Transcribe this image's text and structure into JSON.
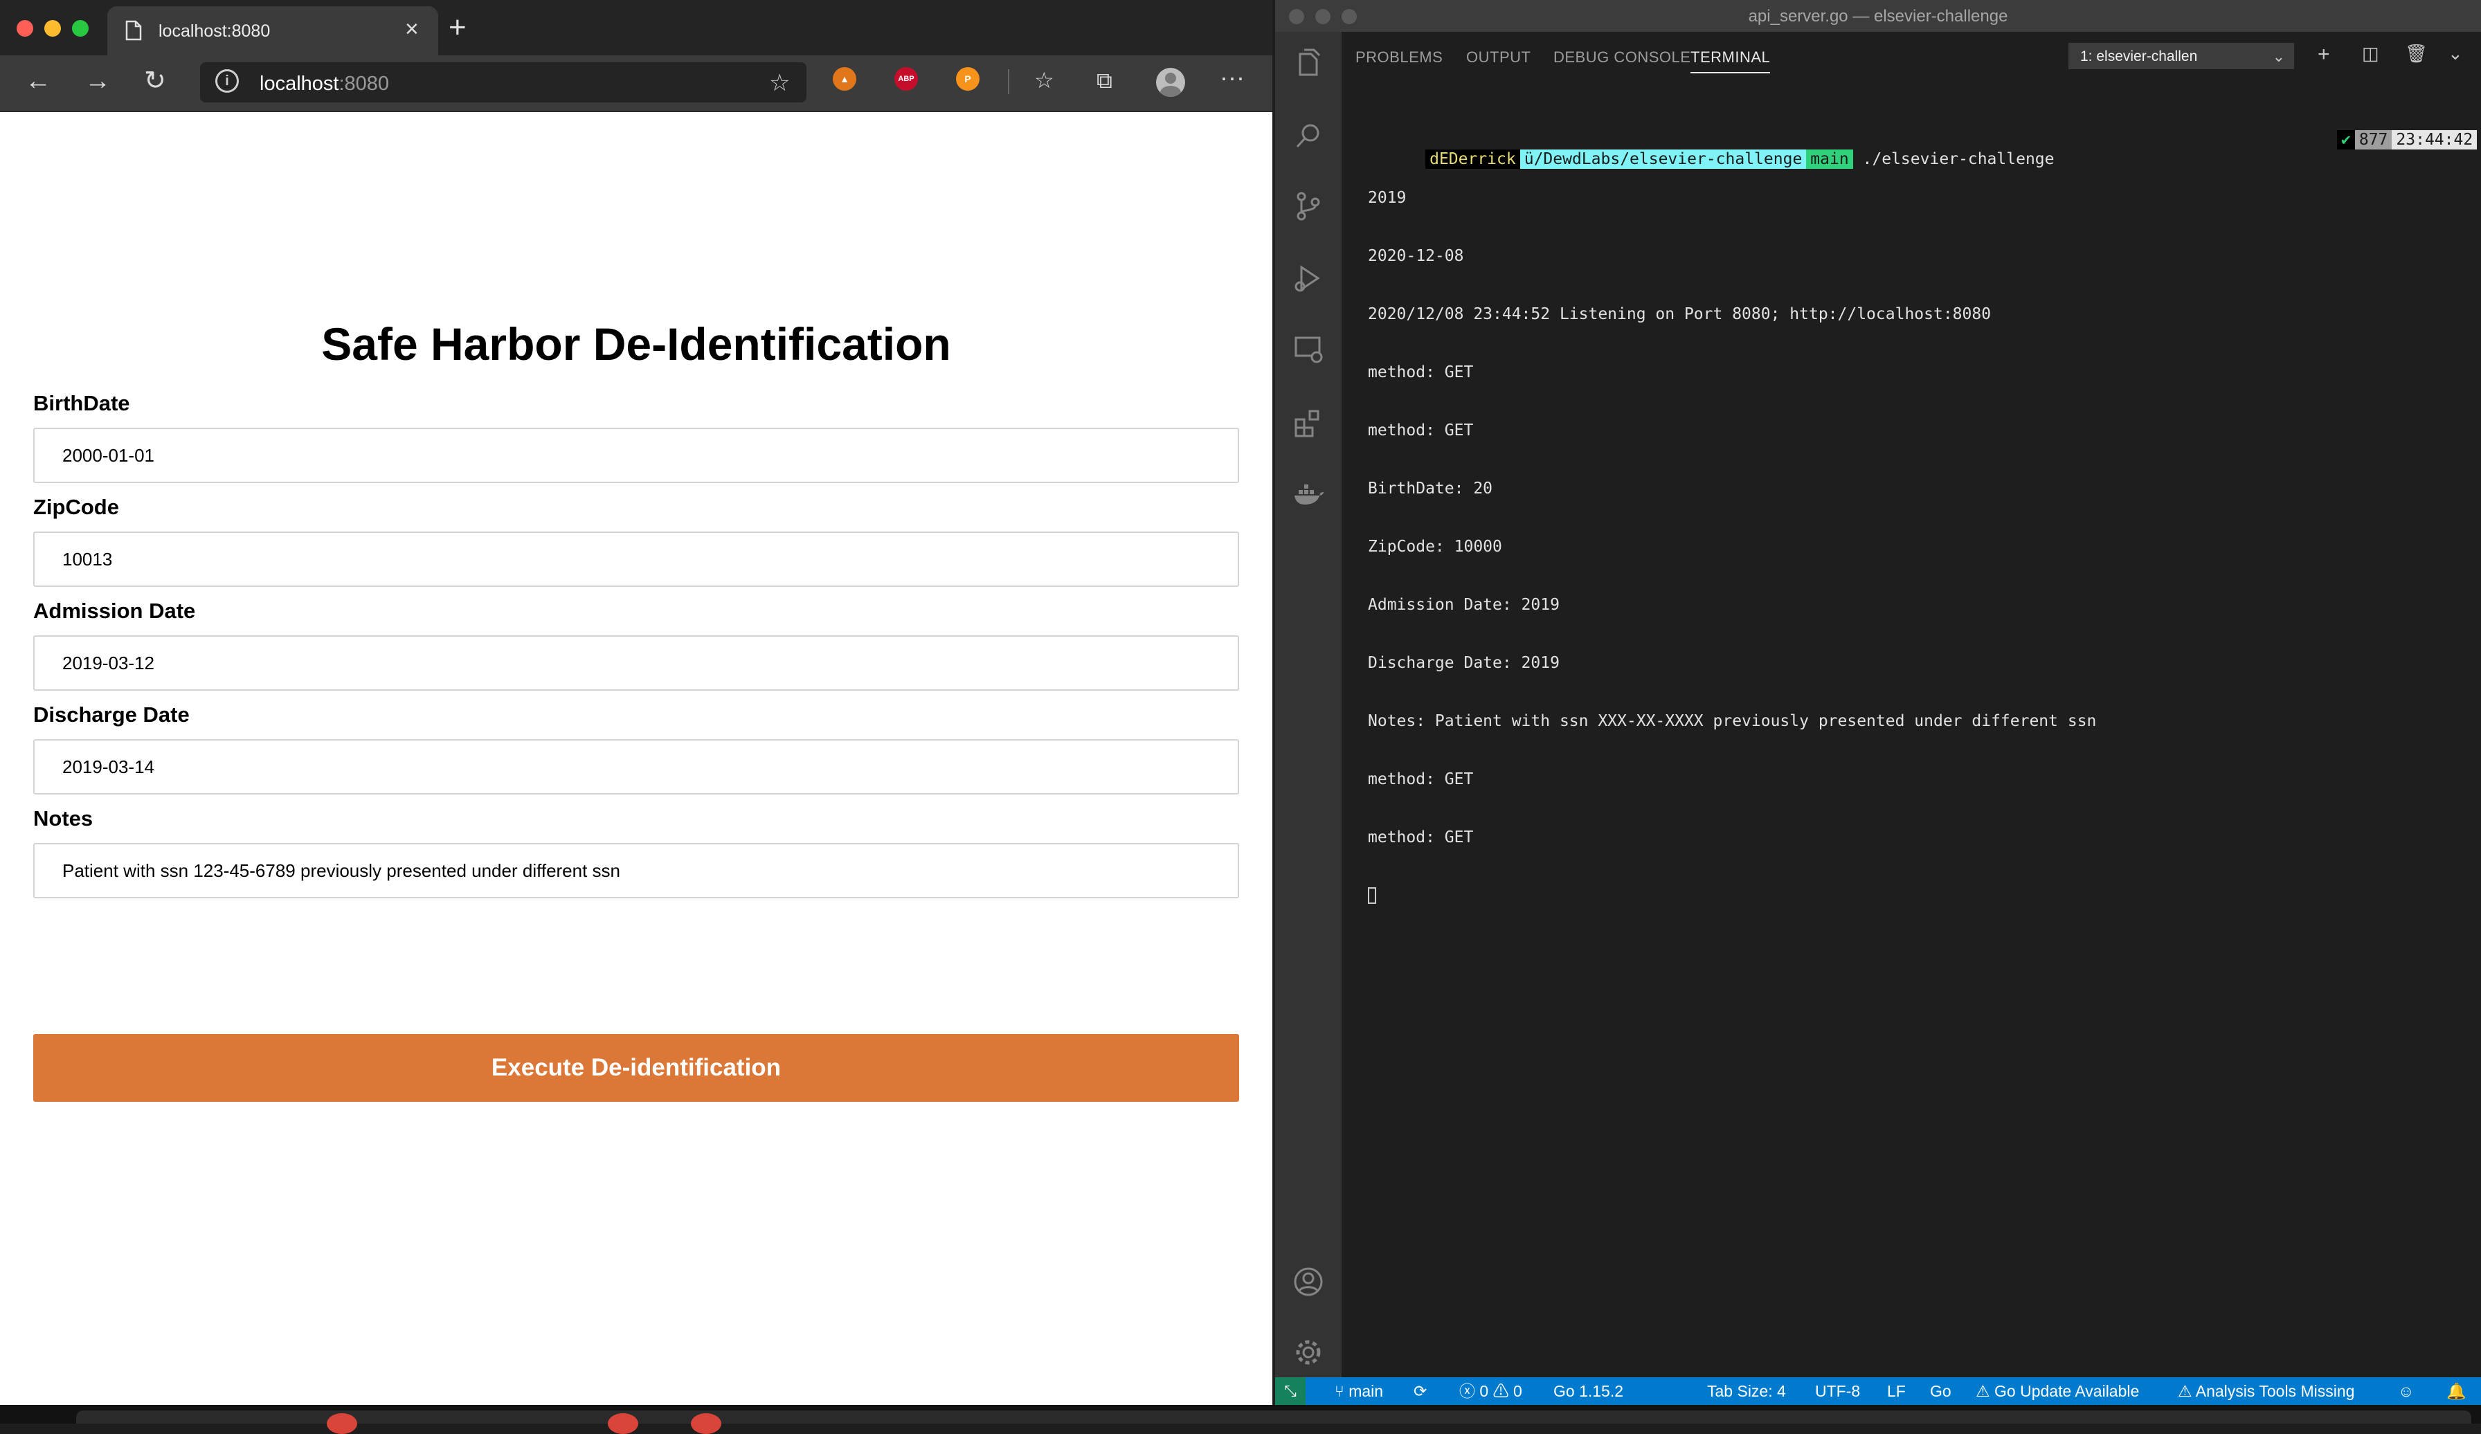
{
  "browser": {
    "tab_title": "localhost:8080",
    "url_host": "localhost",
    "url_port": ":8080",
    "extensions": [
      "metamask-icon",
      "adblock-plus-icon",
      "token-icon"
    ],
    "ext_abp_label": "ABP",
    "ext_token_label": "P"
  },
  "form": {
    "title": "Safe Harbor De-Identification",
    "fields": [
      {
        "label": "BirthDate",
        "value": "2000-01-01"
      },
      {
        "label": "ZipCode",
        "value": "10013"
      },
      {
        "label": "Admission Date",
        "value": "2019-03-12"
      },
      {
        "label": "Discharge Date",
        "value": "2019-03-14"
      },
      {
        "label": "Notes",
        "value": "Patient with ssn 123-45-6789 previously presented under different ssn"
      }
    ],
    "submit_label": "Execute De-identification",
    "submit_color": "#db7838"
  },
  "vscode": {
    "window_title": "api_server.go — elsevier-challenge",
    "panel_tabs": [
      "PROBLEMS",
      "OUTPUT",
      "DEBUG CONSOLE",
      "TERMINAL"
    ],
    "active_tab": "TERMINAL",
    "terminal_select": "1: elsevier-challen",
    "prompt": {
      "user": "dEDerrick",
      "path": "ü/DewdLabs/elsevier-challenge",
      "branch": "main",
      "command": "./elsevier-challenge",
      "status": "✔",
      "history": "877",
      "time": "23:44:42"
    },
    "terminal_lines": [
      "2019",
      "2020-12-08",
      "2020/12/08 23:44:52 Listening on Port 8080; http://localhost:8080",
      "method: GET",
      "method: GET",
      "BirthDate: 20",
      "ZipCode: 10000",
      "Admission Date: 2019",
      "Discharge Date: 2019",
      "Notes: Patient with ssn XXX-XX-XXXX previously presented under different ssn",
      "method: GET",
      "method: GET"
    ],
    "status_bar": {
      "branch": "main",
      "errors": "0",
      "warnings": "0",
      "go_version": "Go 1.15.2",
      "tab_size": "Tab Size: 4",
      "encoding": "UTF-8",
      "eol": "LF",
      "language": "Go",
      "go_update": "Go Update Available",
      "analysis": "Analysis Tools Missing"
    },
    "accent_color": "#007acc"
  }
}
